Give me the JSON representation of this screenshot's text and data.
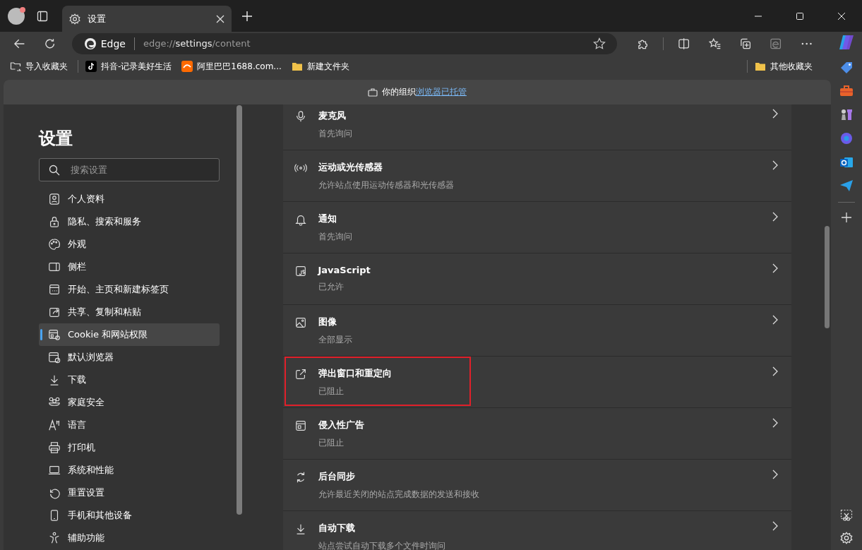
{
  "tabs": [
    {
      "title": "设置",
      "selected": true
    }
  ],
  "address": {
    "site": "Edge",
    "url_prefix": "edge://",
    "url_host": "settings",
    "url_path": "/content"
  },
  "bookmarks": [
    {
      "label": "导入收藏夹"
    },
    {
      "label": "抖音-记录美好生活"
    },
    {
      "label": "阿里巴巴1688.com..."
    },
    {
      "label": "新建文件夹"
    }
  ],
  "other_bookmarks": "其他收藏夹",
  "infobar": {
    "text": "你的组织",
    "link": "浏览器已托管"
  },
  "settings_nav": {
    "title": "设置",
    "search_placeholder": "搜索设置",
    "items": [
      {
        "label": "个人资料",
        "selected": false
      },
      {
        "label": "隐私、搜索和服务",
        "selected": false
      },
      {
        "label": "外观",
        "selected": false
      },
      {
        "label": "侧栏",
        "selected": false
      },
      {
        "label": "开始、主页和新建标签页",
        "selected": false
      },
      {
        "label": "共享、复制和粘贴",
        "selected": false
      },
      {
        "label": "Cookie 和网站权限",
        "selected": true
      },
      {
        "label": "默认浏览器",
        "selected": false
      },
      {
        "label": "下载",
        "selected": false
      },
      {
        "label": "家庭安全",
        "selected": false
      },
      {
        "label": "语言",
        "selected": false
      },
      {
        "label": "打印机",
        "selected": false
      },
      {
        "label": "系统和性能",
        "selected": false
      },
      {
        "label": "重置设置",
        "selected": false
      },
      {
        "label": "手机和其他设备",
        "selected": false
      },
      {
        "label": "辅助功能",
        "selected": false
      }
    ]
  },
  "permissions": [
    {
      "title": "麦克风",
      "subtitle": "首先询问",
      "highlighted": false
    },
    {
      "title": "运动或光传感器",
      "subtitle": "允许站点使用运动传感器和光传感器",
      "highlighted": false
    },
    {
      "title": "通知",
      "subtitle": "首先询问",
      "highlighted": false
    },
    {
      "title": "JavaScript",
      "subtitle": "已允许",
      "highlighted": false
    },
    {
      "title": "图像",
      "subtitle": "全部显示",
      "highlighted": false
    },
    {
      "title": "弹出窗口和重定向",
      "subtitle": "已阻止",
      "highlighted": true
    },
    {
      "title": "侵入性广告",
      "subtitle": "已阻止",
      "highlighted": false
    },
    {
      "title": "后台同步",
      "subtitle": "允许最近关闭的站点完成数据的发送和接收",
      "highlighted": false
    },
    {
      "title": "自动下载",
      "subtitle": "站点尝试自动下载多个文件时询问",
      "highlighted": false
    }
  ]
}
